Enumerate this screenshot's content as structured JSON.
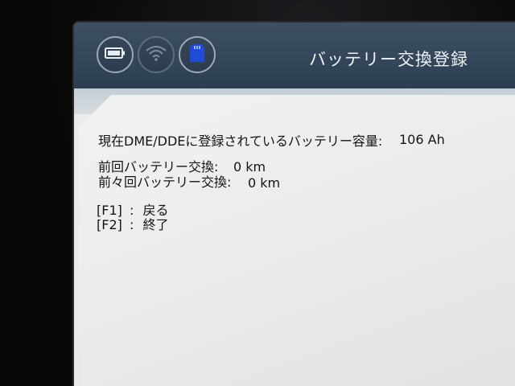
{
  "header": {
    "title": "バッテリー交換登録",
    "icons": [
      "battery-icon",
      "wifi-icon",
      "sd-card-icon"
    ],
    "colors": {
      "background": "#3b4c5f",
      "title_text": "#eef2f5",
      "sd_card_accent": "#1f4bd8"
    }
  },
  "info": {
    "capacity_label": "現在DME/DDEに登録されているバッテリー容量:",
    "capacity_value": "106 Ah",
    "last_label": "前回バッテリー交換:",
    "last_value": "0 km",
    "previous_label": "前々回バッテリー交換:",
    "previous_value": "0 km"
  },
  "keys": [
    {
      "key": "[F1]",
      "sep": ":",
      "action": "戻る"
    },
    {
      "key": "[F2]",
      "sep": ":",
      "action": "終了"
    }
  ]
}
